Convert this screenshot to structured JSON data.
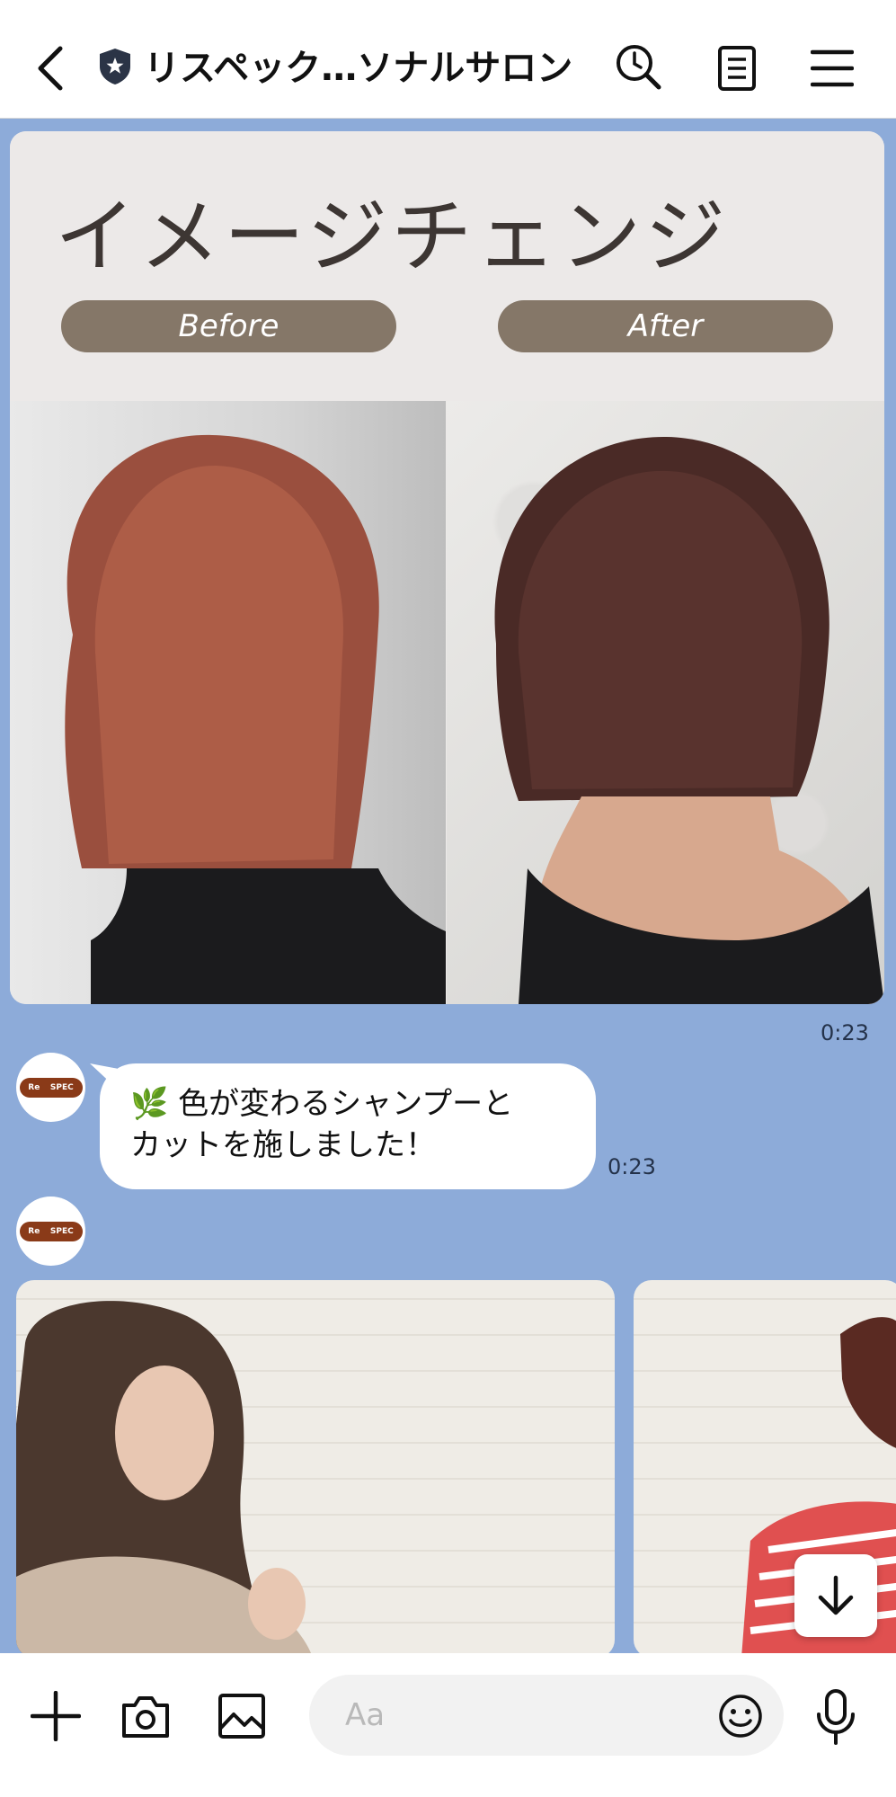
{
  "header": {
    "title": "リスペック…ソナルサロン",
    "icons": [
      "back-icon",
      "shield-star-icon",
      "search-history-icon",
      "notes-icon",
      "menu-icon"
    ]
  },
  "card": {
    "heading": "イメージチェンジ",
    "before_label": "Before",
    "after_label": "After",
    "time": "0:23"
  },
  "message": {
    "emoji": "🌿",
    "line1": "色が変わるシャンプーと",
    "line2": "カットを施しました！",
    "time": "0:23"
  },
  "avatar": {
    "logo_left": "Re",
    "logo_mid": "SPEC"
  },
  "input": {
    "placeholder": "Aa"
  },
  "colors": {
    "chat_background": "#8dabd9",
    "pill": "#857768",
    "card_bg": "#ece9e8"
  }
}
